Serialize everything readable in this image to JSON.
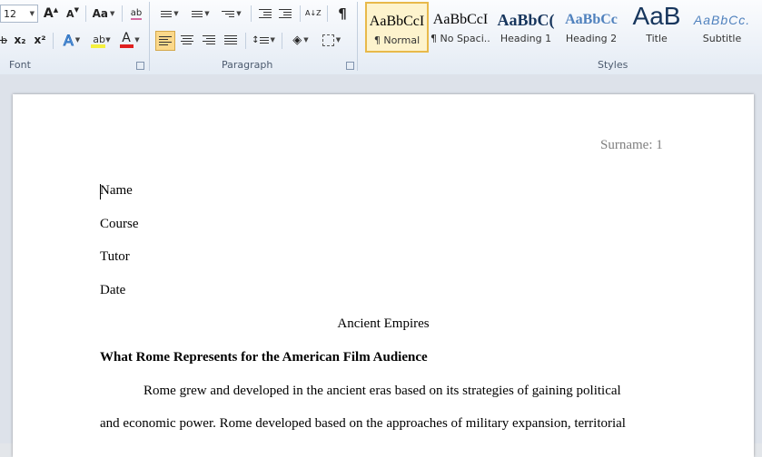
{
  "ribbon": {
    "font_group": {
      "label": "Font",
      "font_size": "12",
      "grow_label": "A",
      "shrink_label": "A",
      "case_label": "Aa",
      "clear_label": "ab",
      "subscript_label": "x₂",
      "superscript_label": "x²",
      "text_effects_label": "A",
      "font_color_label": "A",
      "highlight_color": "#f5f03c",
      "font_color": "#e02020"
    },
    "paragraph_group": {
      "label": "Paragraph",
      "sort_label": "A↓Z",
      "show_marks_label": "¶"
    },
    "styles_group": {
      "label": "Styles",
      "items": [
        {
          "sample": "AaBbCcI",
          "name": "¶ Normal",
          "selected": true
        },
        {
          "sample": "AaBbCcI",
          "name": "¶ No Spaci...",
          "selected": false
        },
        {
          "sample": "AaBbC(",
          "name": "Heading 1",
          "selected": false
        },
        {
          "sample": "AaBbCc",
          "name": "Heading 2",
          "selected": false
        },
        {
          "sample": "AaB",
          "name": "Title",
          "selected": false
        },
        {
          "sample": "AaBbCc.",
          "name": "Subtitle",
          "selected": false
        }
      ]
    }
  },
  "document": {
    "header": "Surname: 1",
    "lines": {
      "name": "Name",
      "course": "Course",
      "tutor": "Tutor",
      "date": "Date",
      "title": "Ancient Empires",
      "heading": "What Rome Represents for the American Film Audience",
      "para1": "Rome grew and developed in the ancient eras based on its strategies of gaining political",
      "para2": "and economic power. Rome developed based on the approaches of military expansion, territorial"
    }
  },
  "colors": {
    "ribbon_border": "#aebdd0",
    "selected_style_border": "#e8b94a",
    "selected_style_bg": "#fdf3cd",
    "active_button_bg": "#fbd88a",
    "heading1_blue": "#17365d",
    "heading2_blue": "#4f81bd",
    "header_gray": "#7f7f7f"
  }
}
